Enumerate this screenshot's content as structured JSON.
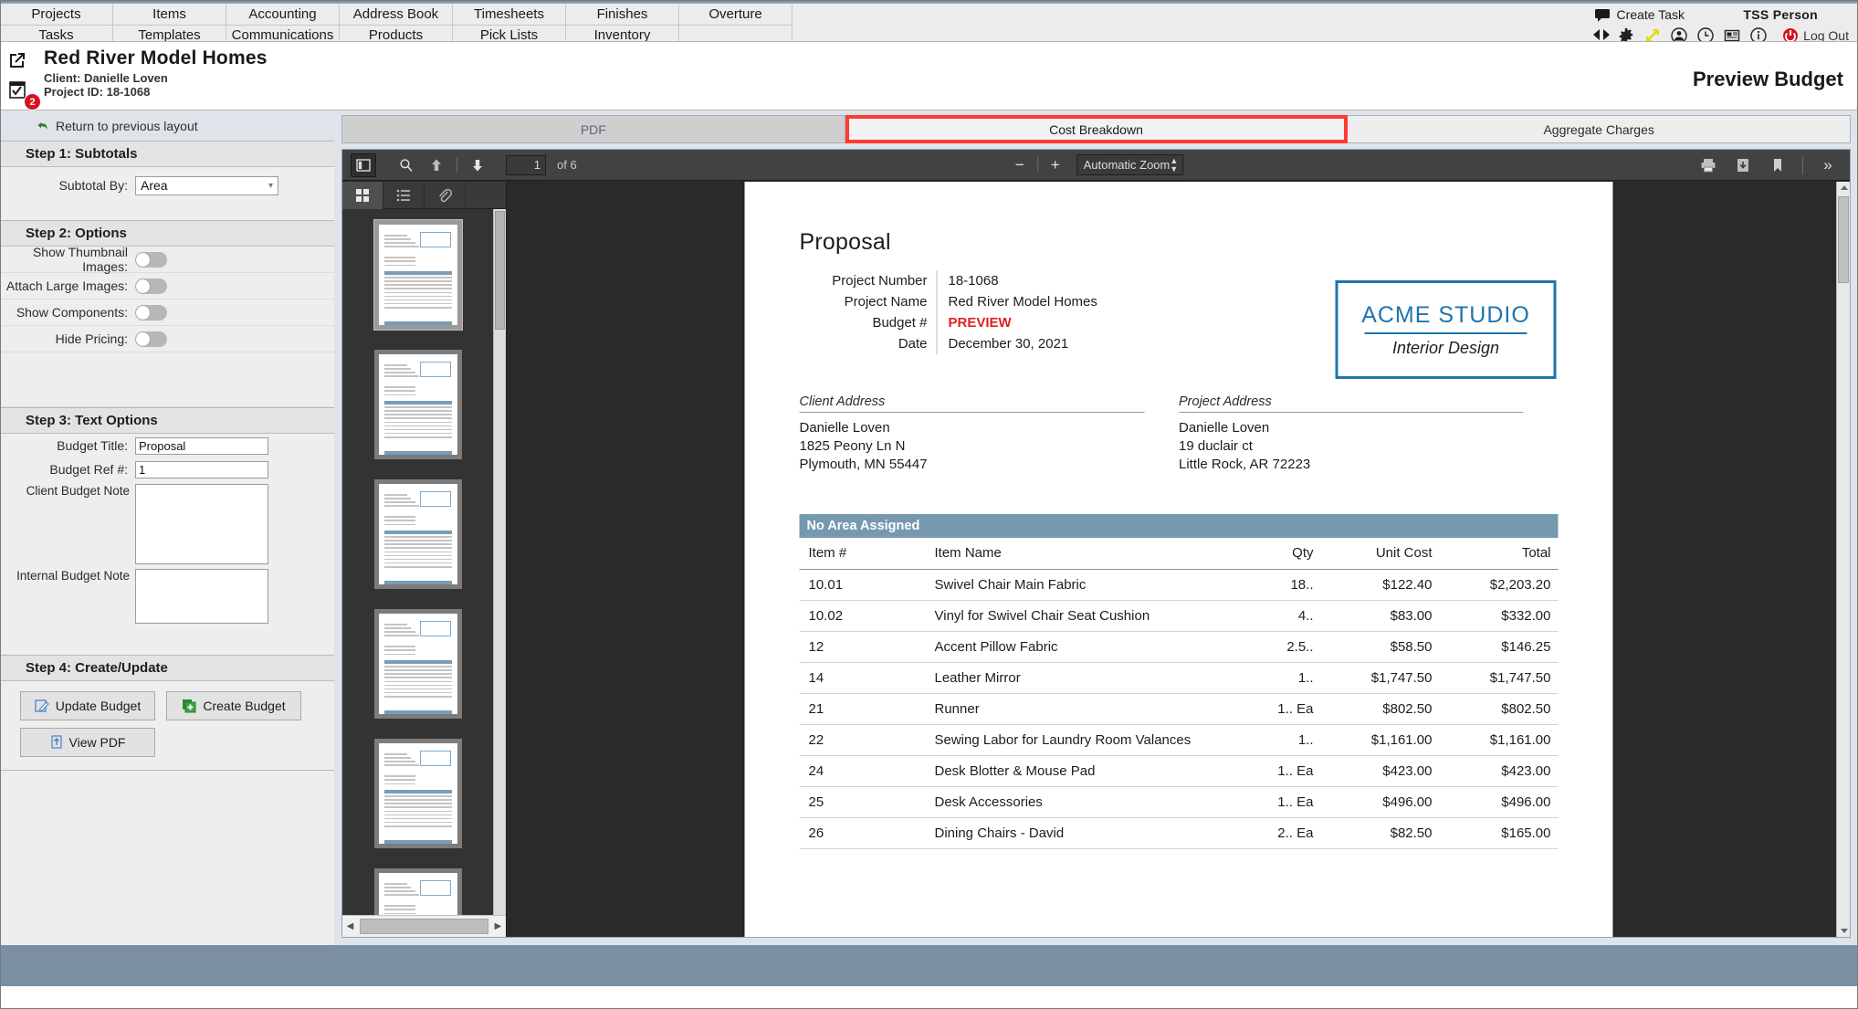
{
  "nav": {
    "row1": [
      "Projects",
      "Items",
      "Accounting",
      "Address Book",
      "Timesheets",
      "Finishes",
      "Overture"
    ],
    "row2": [
      "Tasks",
      "Templates",
      "Communications",
      "Products",
      "Pick Lists",
      "Inventory",
      ""
    ]
  },
  "topright": {
    "create_task": "Create Task",
    "user": "TSS Person",
    "logout": "Log Out",
    "icons": [
      "speech-bubble-icon",
      "prev-next-icon",
      "gear-icon",
      "resize-icon",
      "user-icon",
      "clock-icon",
      "news-icon",
      "info-icon",
      "power-icon"
    ]
  },
  "project": {
    "title": "Red River Model Homes",
    "client": "Client: Danielle Loven",
    "project_id": "Project ID: 18-1068",
    "badge_count": "2",
    "page_title": "Preview Budget"
  },
  "sidebar": {
    "return_link": "Return to previous layout",
    "step1": {
      "title": "Step 1: Subtotals",
      "subtotal_by_label": "Subtotal By:",
      "subtotal_by_value": "Area"
    },
    "step2": {
      "title": "Step 2: Options",
      "options": [
        {
          "label": "Show Thumbnail Images:",
          "on": false
        },
        {
          "label": "Attach Large Images:",
          "on": false
        },
        {
          "label": "Show Components:",
          "on": false
        },
        {
          "label": "Hide Pricing:",
          "on": false
        }
      ]
    },
    "step3": {
      "title": "Step 3: Text Options",
      "budget_title_label": "Budget Title:",
      "budget_title_value": "Proposal",
      "budget_ref_label": "Budget Ref #:",
      "budget_ref_value": "1",
      "client_note_label": "Client Budget Note",
      "client_note_value": "",
      "internal_note_label": "Internal Budget Note",
      "internal_note_value": ""
    },
    "step4": {
      "title": "Step 4: Create/Update",
      "update_budget": "Update Budget",
      "create_budget": "Create Budget",
      "view_pdf": "View PDF"
    }
  },
  "tabs": [
    {
      "label": "PDF",
      "state": "inactive"
    },
    {
      "label": "Cost Breakdown",
      "state": "selected"
    },
    {
      "label": "Aggregate Charges",
      "state": "normal"
    }
  ],
  "pdf_toolbar": {
    "sidebar_toggle": "sidebar-toggle-icon",
    "find": "search-icon",
    "prev_page": "up-arrow-icon",
    "next_page": "down-arrow-icon",
    "page_number": "1",
    "page_count": "of 6",
    "zoom_out": "−",
    "zoom_in": "+",
    "zoom_value": "Automatic Zoom",
    "print": "print-icon",
    "download": "download-icon",
    "bookmark": "bookmark-icon",
    "more": "»"
  },
  "thumbnails": {
    "tabs": [
      "thumbnails-icon",
      "outline-icon",
      "attachments-icon"
    ],
    "count": 6,
    "selected": 1
  },
  "document": {
    "title": "Proposal",
    "meta": [
      {
        "label": "Project Number",
        "value": "18-1068",
        "highlight": false
      },
      {
        "label": "Project Name",
        "value": "Red River Model Homes",
        "highlight": false
      },
      {
        "label": "Budget #",
        "value": "PREVIEW",
        "highlight": true
      },
      {
        "label": "Date",
        "value": "December 30, 2021",
        "highlight": false
      }
    ],
    "logo": {
      "main": "ACME STUDIO",
      "sub": "Interior Design"
    },
    "client_address": {
      "heading": "Client Address",
      "lines": [
        "Danielle Loven",
        "1825 Peony Ln N",
        "Plymouth, MN 55447"
      ]
    },
    "project_address": {
      "heading": "Project Address",
      "lines": [
        "Danielle Loven",
        "19 duclair ct",
        "Little Rock, AR 72223"
      ]
    },
    "area_header": "No Area Assigned",
    "columns": [
      "Item #",
      "Item Name",
      "Qty",
      "Unit Cost",
      "Total"
    ],
    "rows": [
      {
        "item": "10.01",
        "name": "Swivel Chair Main Fabric",
        "qty": "18..",
        "unit": "$122.40",
        "total": "$2,203.20"
      },
      {
        "item": "10.02",
        "name": "Vinyl for Swivel Chair Seat Cushion",
        "qty": "4..",
        "unit": "$83.00",
        "total": "$332.00"
      },
      {
        "item": "12",
        "name": "Accent Pillow Fabric",
        "qty": "2.5..",
        "unit": "$58.50",
        "total": "$146.25"
      },
      {
        "item": "14",
        "name": "Leather Mirror",
        "qty": "1..",
        "unit": "$1,747.50",
        "total": "$1,747.50"
      },
      {
        "item": "21",
        "name": "Runner",
        "qty": "1.. Ea",
        "unit": "$802.50",
        "total": "$802.50"
      },
      {
        "item": "22",
        "name": "Sewing Labor for Laundry Room Valances",
        "qty": "1..",
        "unit": "$1,161.00",
        "total": "$1,161.00"
      },
      {
        "item": "24",
        "name": "Desk Blotter & Mouse Pad",
        "qty": "1.. Ea",
        "unit": "$423.00",
        "total": "$423.00"
      },
      {
        "item": "25",
        "name": "Desk Accessories",
        "qty": "1.. Ea",
        "unit": "$496.00",
        "total": "$496.00"
      },
      {
        "item": "26",
        "name": "Dining Chairs - David",
        "qty": "2.. Ea",
        "unit": "$82.50",
        "total": "$165.00"
      }
    ]
  },
  "colors": {
    "accent_red": "#ff3b30",
    "area_band": "#7698b0",
    "logo_blue": "#1f75ad",
    "footer": "#7b8fa3",
    "preview_red": "#e02020"
  }
}
